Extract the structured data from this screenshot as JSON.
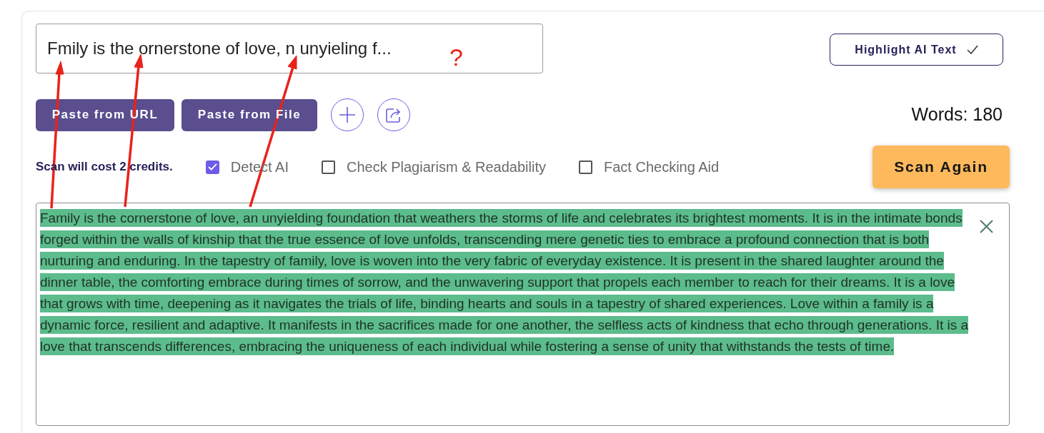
{
  "query_field": {
    "value": "Fmily is the ornerstone of love, n unyieling f..."
  },
  "highlight_button": {
    "label": "Highlight AI Text"
  },
  "paste_buttons": [
    {
      "label": "Paste from URL"
    },
    {
      "label": "Paste from File"
    }
  ],
  "icon_buttons": [
    {
      "kind": "add"
    },
    {
      "kind": "export"
    }
  ],
  "word_count": "Words: 180",
  "cost_note": "Scan will cost 2 credits.",
  "options": [
    {
      "label": "Detect AI",
      "checked": true
    },
    {
      "label": "Check Plagiarism & Readability",
      "checked": false
    },
    {
      "label": "Fact Checking Aid",
      "checked": false
    }
  ],
  "scan_button": {
    "label": "Scan Again"
  },
  "editor": {
    "text": "Family is the cornerstone of love, an unyielding foundation that weathers the storms of life and celebrates its brightest moments. It is in the intimate bonds forged within the walls of kinship that the true essence of love unfolds, transcending mere genetic ties to embrace a profound connection that is both nurturing and enduring. In the tapestry of family, love is woven into the very fabric of everyday existence. It is present in the shared laughter around the dinner table, the comforting embrace during times of sorrow, and the unwavering support that propels each member to reach for their dreams. It is a love that grows with time, deepening as it navigates the trials of life, binding hearts and souls in a tapestry of shared experiences. Love within a family is a dynamic force, resilient and adaptive. It manifests in the sacrifices made for one another, the selfless acts of kindness that echo through generations. It is a love that transcends differences, embracing the uniqueness of each individual while fostering a sense of unity that withstands the tests of time.",
    "highlighted": true
  },
  "annotation": {
    "mark": "?"
  }
}
